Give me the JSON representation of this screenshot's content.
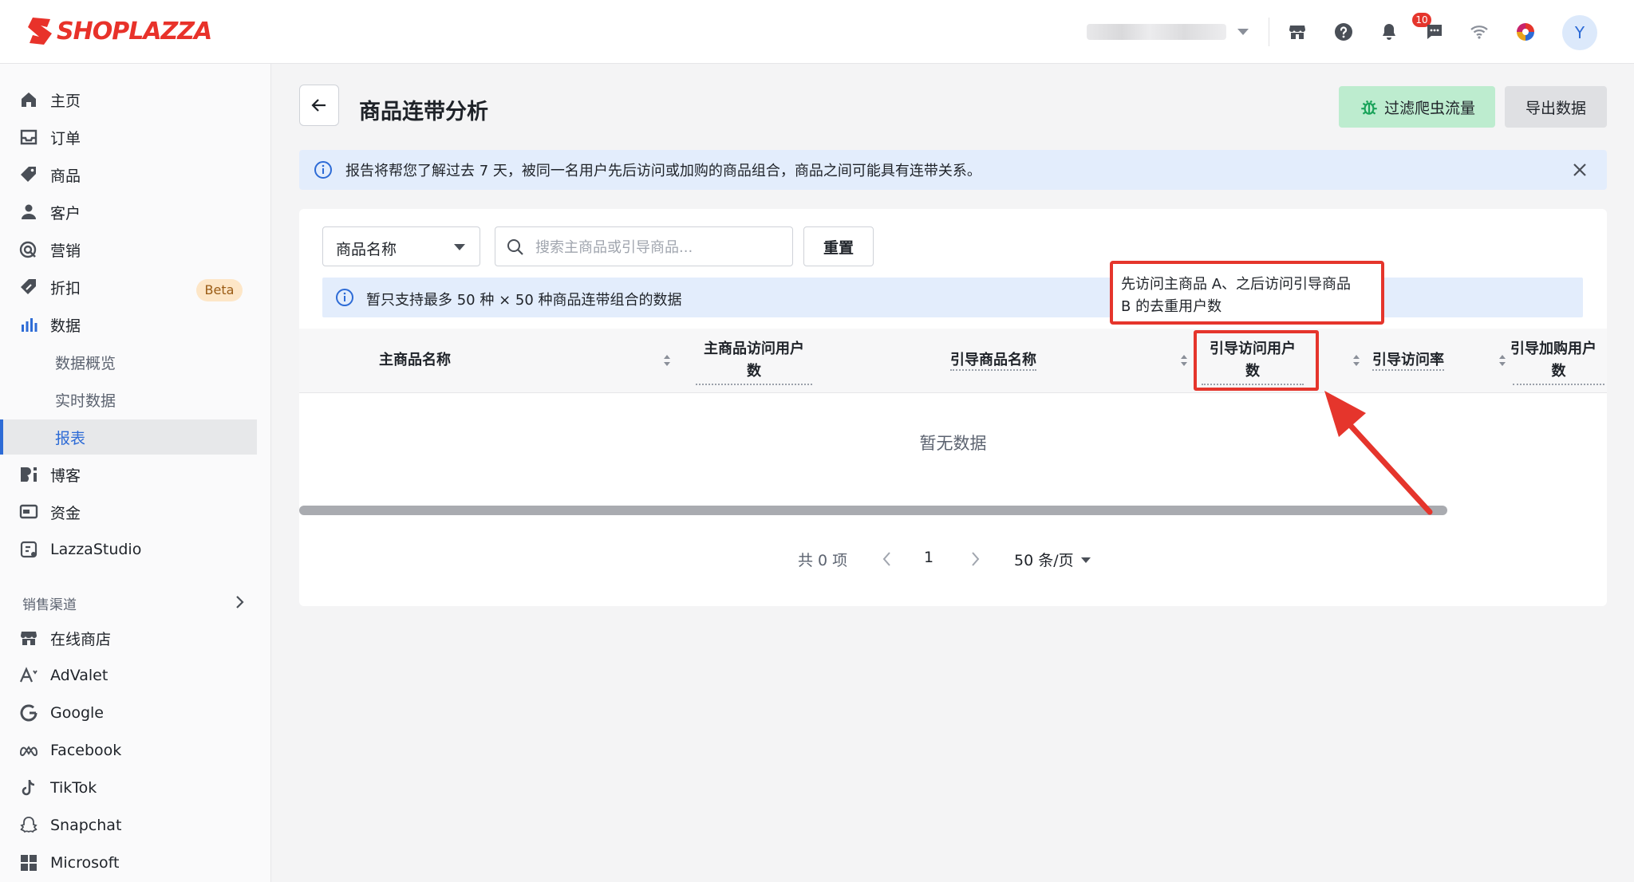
{
  "app": {
    "logo_text": "SHOPLAZZA",
    "notification_count": "10",
    "avatar_initial": "Y",
    "brand_color": "#e8322a",
    "accent_color": "#2d6bd6"
  },
  "topbar_icons": [
    "store-icon",
    "help-icon",
    "bell-icon",
    "chat-icon",
    "wifi-icon",
    "color-wheel-icon"
  ],
  "sidebar": {
    "items": [
      {
        "label": "主页",
        "icon": "home-icon"
      },
      {
        "label": "订单",
        "icon": "inbox-icon"
      },
      {
        "label": "商品",
        "icon": "tag-icon"
      },
      {
        "label": "客户",
        "icon": "person-icon"
      },
      {
        "label": "营销",
        "icon": "target-icon"
      },
      {
        "label": "折扣",
        "icon": "discount-icon"
      },
      {
        "label": "数据",
        "icon": "bar-chart-icon"
      }
    ],
    "beta_label": "Beta",
    "data_sub": [
      {
        "label": "数据概览"
      },
      {
        "label": "实时数据"
      },
      {
        "label": "报表"
      }
    ],
    "items2": [
      {
        "label": "博客",
        "icon": "blog-icon"
      },
      {
        "label": "资金",
        "icon": "wallet-icon"
      },
      {
        "label": "LazzaStudio",
        "icon": "studio-icon"
      }
    ],
    "sales_channels_heading": "销售渠道",
    "channels": [
      {
        "label": "在线商店",
        "icon": "store-icon"
      },
      {
        "label": "AdValet",
        "icon": "advalet-icon"
      },
      {
        "label": "Google",
        "icon": "google-icon"
      },
      {
        "label": "Facebook",
        "icon": "meta-icon"
      },
      {
        "label": "TikTok",
        "icon": "tiktok-icon"
      },
      {
        "label": "Snapchat",
        "icon": "snapchat-icon"
      },
      {
        "label": "Microsoft",
        "icon": "microsoft-icon"
      }
    ]
  },
  "page": {
    "title": "商品连带分析",
    "filter_bot_label": "过滤爬虫流量",
    "export_label": "导出数据",
    "info_text": "报告将帮您了解过去 7 天，被同一名用户先后访问或加购的商品组合，商品之间可能具有连带关系。"
  },
  "filters": {
    "select_value": "商品名称",
    "search_placeholder": "搜索主商品或引导商品...",
    "reset_label": "重置",
    "note_text": "暂只支持最多 50 种 × 50 种商品连带组合的数据"
  },
  "table": {
    "columns": {
      "main_name": "主商品名称",
      "main_visits_l1": "主商品访问用户",
      "main_visits_l2": "数",
      "guide_name": "引导商品名称",
      "guide_visits_l1": "引导访问用户",
      "guide_visits_l2": "数",
      "guide_rate": "引导访问率",
      "guide_cart_l1": "引导加购用户",
      "guide_cart_l2": "数"
    },
    "empty_text": "暂无数据"
  },
  "pagination": {
    "total": "共 0 项",
    "current_page": "1",
    "page_size": "50 条/页"
  },
  "annotation": {
    "tooltip_l1": "先访问主商品 A、之后访问引导商品",
    "tooltip_l2": "B 的去重用户数",
    "highlight_color": "#e5352c"
  }
}
